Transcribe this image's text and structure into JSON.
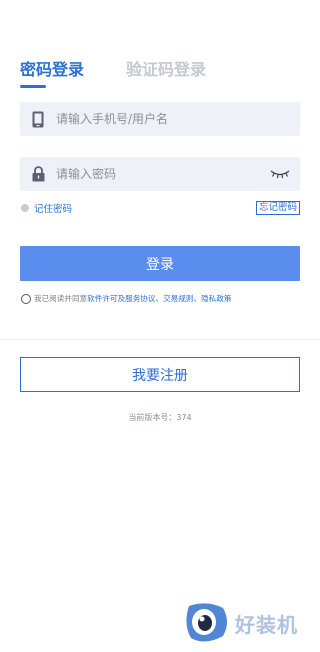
{
  "tabs": [
    {
      "label": "密码登录",
      "active": true
    },
    {
      "label": "验证码登录",
      "active": false
    }
  ],
  "account_field": {
    "placeholder": "请输入手机号/用户名",
    "icon": "phone-icon"
  },
  "password_field": {
    "placeholder": "请输入密码",
    "icon": "lock-icon",
    "toggle_icon": "eye-closed-icon"
  },
  "remember_label": "记住密码",
  "forgot_label": "忘记密码",
  "login_label": "登录",
  "agreement": {
    "prefix": "我已阅读并同意",
    "link1": "软件许可及服务协议",
    "sep1": "、",
    "link2": "交易规则",
    "sep2": "、",
    "link3": "隐私政策"
  },
  "register_label": "我要注册",
  "version_text": "当前版本号：374",
  "watermark": {
    "text": "好装机"
  },
  "colors": {
    "accent": "#2e6fd2",
    "button": "#5b8def",
    "field_bg": "#eef1f7",
    "inactive_tab": "#c4c8cf"
  }
}
